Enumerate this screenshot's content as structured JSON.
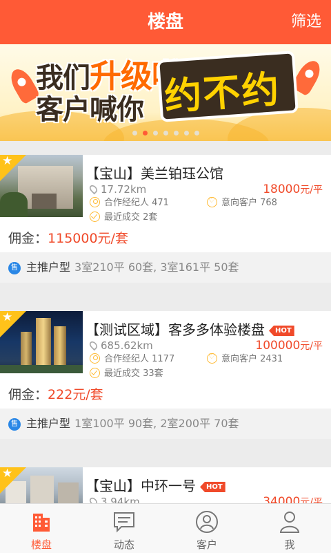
{
  "header": {
    "title": "楼盘",
    "filter_label": "筛选"
  },
  "banner": {
    "line1_a": "我们",
    "line1_highlight": "升级啦",
    "line2": "客户喊你",
    "big_text": "约不约",
    "dots_count": 7,
    "active_dot": 1
  },
  "listings": [
    {
      "name": "【宝山】美兰铂珏公馆",
      "hot": false,
      "distance": "17.72km",
      "price": "18000",
      "price_unit": "元/平",
      "agents_label": "合作经纪人 471",
      "clients_label": "意向客户 768",
      "recent_label": "最近成交 2套",
      "commission_label": "佣金：",
      "commission_value": "115000元/套",
      "sale_badge": "售",
      "main_type_label": "主推户型",
      "main_types": "3室210平 60套, 3室161平 50套"
    },
    {
      "name": "【测试区域】客多多体验楼盘",
      "hot": true,
      "hot_label": "HOT",
      "distance": "685.62km",
      "price": "100000",
      "price_unit": "元/平",
      "agents_label": "合作经纪人 1177",
      "clients_label": "意向客户 2431",
      "recent_label": "最近成交 33套",
      "commission_label": "佣金：",
      "commission_value": "222元/套",
      "sale_badge": "售",
      "main_type_label": "主推户型",
      "main_types": "1室100平 90套, 2室200平 70套"
    },
    {
      "name": "【宝山】中环一号",
      "hot": true,
      "hot_label": "HOT",
      "distance": "3.94km",
      "price": "34000",
      "price_unit": "元/平"
    }
  ],
  "tabs": [
    {
      "label": "楼盘",
      "icon": "building-icon",
      "active": true
    },
    {
      "label": "动态",
      "icon": "message-icon",
      "active": false
    },
    {
      "label": "客户",
      "icon": "person-circle-icon",
      "active": false
    },
    {
      "label": "我",
      "icon": "person-icon",
      "active": false
    }
  ],
  "colors": {
    "accent": "#ff5a36",
    "price": "#f04a2a",
    "star_corner": "#ffc21a",
    "icon_yellow": "#ffba33",
    "sale_badge": "#2a87e6"
  }
}
